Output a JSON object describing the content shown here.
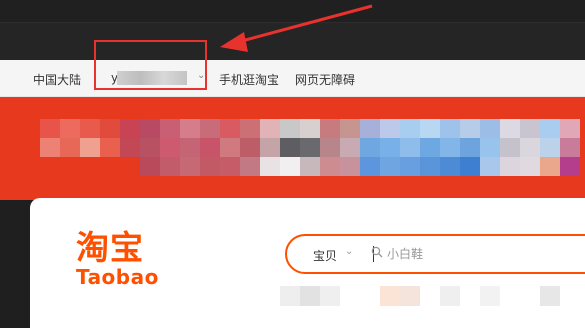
{
  "nav": {
    "region": "中国大陆",
    "user_prefix": "y",
    "mobile": "手机逛淘宝",
    "accessibility": "网页无障碍"
  },
  "logo": {
    "cn": "淘宝",
    "en": "Taobao"
  },
  "search": {
    "scope": "宝贝",
    "placeholder": "小白鞋"
  },
  "colors": {
    "brand": "#ff5000",
    "banner": "#e6391e",
    "annotation": "#e8322e"
  },
  "icons": {
    "chevron": "chevron-down-icon",
    "search": "search-icon"
  }
}
